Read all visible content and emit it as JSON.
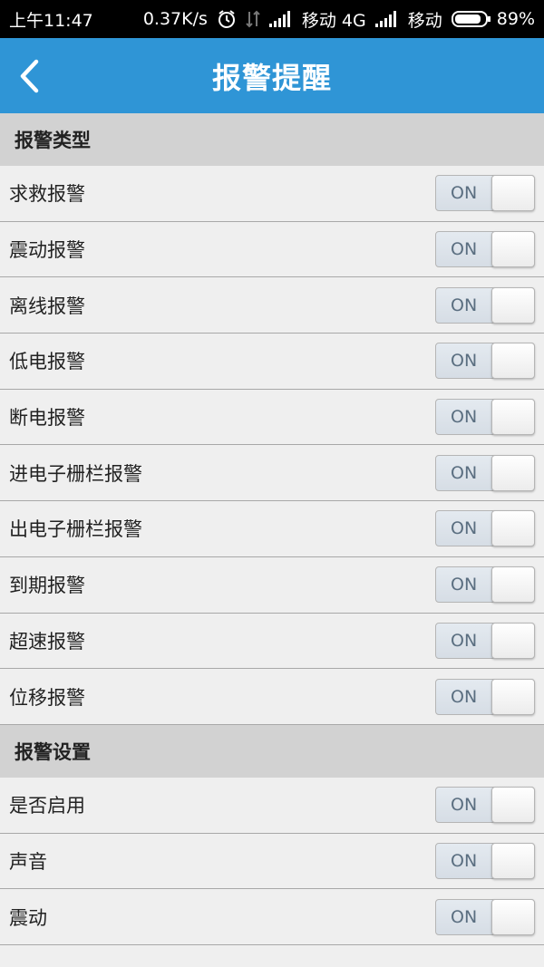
{
  "status_bar": {
    "time": "上午11:47",
    "network_speed": "0.37K/s",
    "carrier1": "移动 4G",
    "carrier2": "移动",
    "battery": "89%",
    "battery_level": 0.89,
    "icons": [
      "alarm-clock-icon",
      "data-arrows-icon",
      "signal-icon",
      "battery-icon"
    ]
  },
  "header": {
    "title": "报警提醒",
    "back_icon": "chevron-left-icon",
    "color": "#2f95d6"
  },
  "sections": [
    {
      "title": "报警类型",
      "items": [
        {
          "label": "求救报警",
          "toggle": "ON"
        },
        {
          "label": "震动报警",
          "toggle": "ON"
        },
        {
          "label": "离线报警",
          "toggle": "ON"
        },
        {
          "label": "低电报警",
          "toggle": "ON"
        },
        {
          "label": "断电报警",
          "toggle": "ON"
        },
        {
          "label": "进电子栅栏报警",
          "toggle": "ON"
        },
        {
          "label": "出电子栅栏报警",
          "toggle": "ON"
        },
        {
          "label": "到期报警",
          "toggle": "ON"
        },
        {
          "label": "超速报警",
          "toggle": "ON"
        },
        {
          "label": "位移报警",
          "toggle": "ON"
        }
      ]
    },
    {
      "title": "报警设置",
      "items": [
        {
          "label": "是否启用",
          "toggle": "ON"
        },
        {
          "label": "声音",
          "toggle": "ON"
        },
        {
          "label": "震动",
          "toggle": "ON"
        }
      ]
    }
  ]
}
